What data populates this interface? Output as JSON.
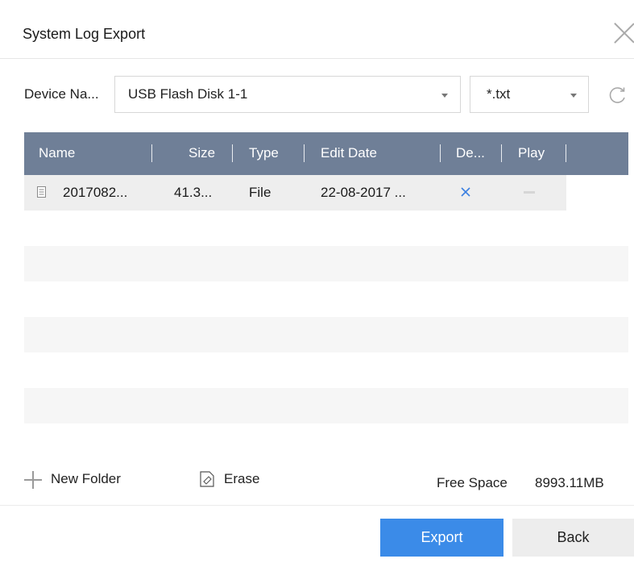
{
  "dialog": {
    "title": "System Log Export"
  },
  "filters": {
    "device_label": "Device Na...",
    "device_value": "USB Flash Disk 1-1",
    "type_value": "*.txt"
  },
  "table": {
    "headers": {
      "name": "Name",
      "size": "Size",
      "type": "Type",
      "edit_date": "Edit Date",
      "delete": "De...",
      "play": "Play"
    },
    "rows": [
      {
        "name": "2017082...",
        "size": "41.3...",
        "type": "File",
        "edit_date": "22-08-2017 ..."
      }
    ]
  },
  "actions": {
    "new_folder": "New Folder",
    "erase": "Erase"
  },
  "storage": {
    "free_space_label": "Free Space",
    "free_space_value": "8993.11MB"
  },
  "buttons": {
    "export": "Export",
    "back": "Back"
  },
  "colors": {
    "header_bg": "#6f7f97",
    "primary": "#3b8be8",
    "delete_icon": "#3b7fe0"
  }
}
